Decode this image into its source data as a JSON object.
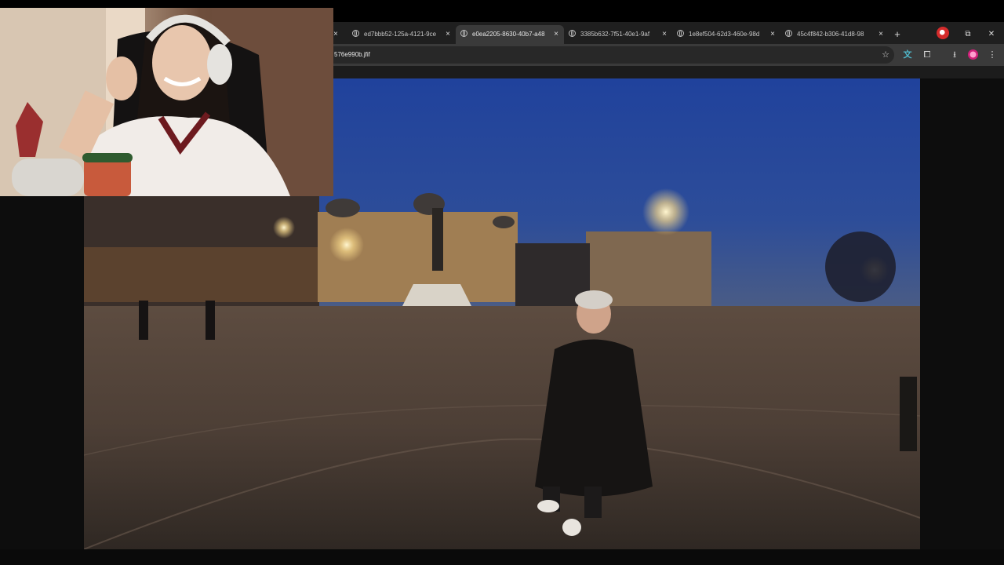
{
  "tabs": [
    {
      "title": "ed7bbb52-125a-4121-9ce",
      "active": false
    },
    {
      "title": "e0ea2205-8630-40b7-a48",
      "active": true
    },
    {
      "title": "3385b632-7f51-40e1-9af",
      "active": false
    },
    {
      "title": "1e8ef504-62d3-460e-98d",
      "active": false
    },
    {
      "title": "45c4f842-b306-41d8-98",
      "active": false
    }
  ],
  "address": {
    "url": "576e990b.jfif"
  },
  "icons": {
    "globe": "globe-icon",
    "close": "close-icon",
    "new_tab": "plus-icon",
    "star": "star-icon",
    "extensions": "puzzle-icon",
    "downloads": "download-icon",
    "menu": "kebab-menu-icon"
  },
  "glyphs": {
    "close": "×",
    "new_tab": "+",
    "star": "☆",
    "restore": "⧉",
    "window_close": "✕",
    "translate": "文",
    "extensions": "⧠",
    "downloads": "⭳",
    "menu": "⋮"
  },
  "colors": {
    "tab_bar": "#1f1f1f",
    "active_tab": "#3a3a3a",
    "omnibox": "#282828",
    "accent_teal": "#4fb6c8"
  }
}
